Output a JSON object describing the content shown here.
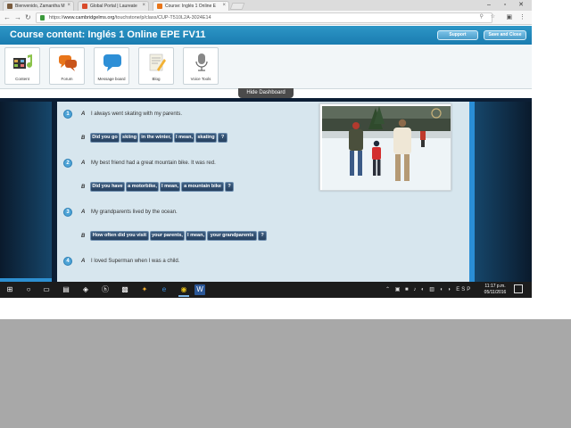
{
  "browser": {
    "tabs": [
      {
        "label": "Bienvenido, Zamantha M",
        "favicon_color": "#7a5c3e"
      },
      {
        "label": "Global Portal | Laureate",
        "favicon_color": "#d94b2b"
      },
      {
        "label": "Course: Inglés 1 Online E",
        "favicon_color": "#e8751a"
      }
    ],
    "url_scheme": "https://",
    "url_host": "www.cambridgelms.org",
    "url_path": "/touchstone/p/class/CUP-T510L2A-3024E14"
  },
  "app": {
    "title": "Course content: Inglés 1 Online EPE FV11",
    "support_label": "Support",
    "save_close_label": "Save and Close",
    "accent_color": "#1a7cb0"
  },
  "dashboard": {
    "tools": [
      {
        "label": "Content",
        "icon": "film-music-icon"
      },
      {
        "label": "Forum",
        "icon": "chat-bubbles-icon"
      },
      {
        "label": "Message board",
        "icon": "message-bubble-icon"
      },
      {
        "label": "Blog",
        "icon": "blog-pencil-icon"
      },
      {
        "label": "Voice Tools",
        "icon": "microphone-icon"
      }
    ],
    "hide_label": "Hide Dashboard"
  },
  "exercise": {
    "questions": [
      {
        "number": "1",
        "a_label": "A",
        "a_text": "I always went skating with my parents.",
        "b_label": "B",
        "chips": [
          "Did you go",
          "skiing",
          "in the winter,",
          "I mean,",
          "skating",
          "?"
        ]
      },
      {
        "number": "2",
        "a_label": "A",
        "a_text": "My best friend had a great mountain bike. It was red.",
        "b_label": "B",
        "chips": [
          "Did you have",
          "a motorbike,",
          "I mean,",
          "a mountain bike",
          "?"
        ]
      },
      {
        "number": "3",
        "a_label": "A",
        "a_text": "My grandparents lived by the ocean.",
        "b_label": "B",
        "chips": [
          "How often did you visit",
          "your parents,",
          "I mean,",
          "your grandparents",
          "?"
        ]
      },
      {
        "number": "4",
        "a_label": "A",
        "a_text": "I loved Superman when I was a child."
      }
    ]
  },
  "taskbar": {
    "time": "11:17 p.m.",
    "date": "05/11/2016",
    "language": "ESP"
  }
}
